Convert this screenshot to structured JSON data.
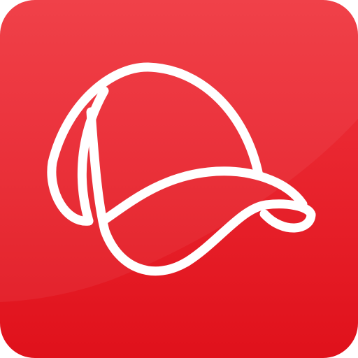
{
  "icon": {
    "name": "baseball-cap-icon",
    "colors": {
      "background_top": "#f0363f",
      "background_bottom": "#e0111b",
      "highlight": "#f44a52",
      "stroke": "#ffffff"
    }
  }
}
